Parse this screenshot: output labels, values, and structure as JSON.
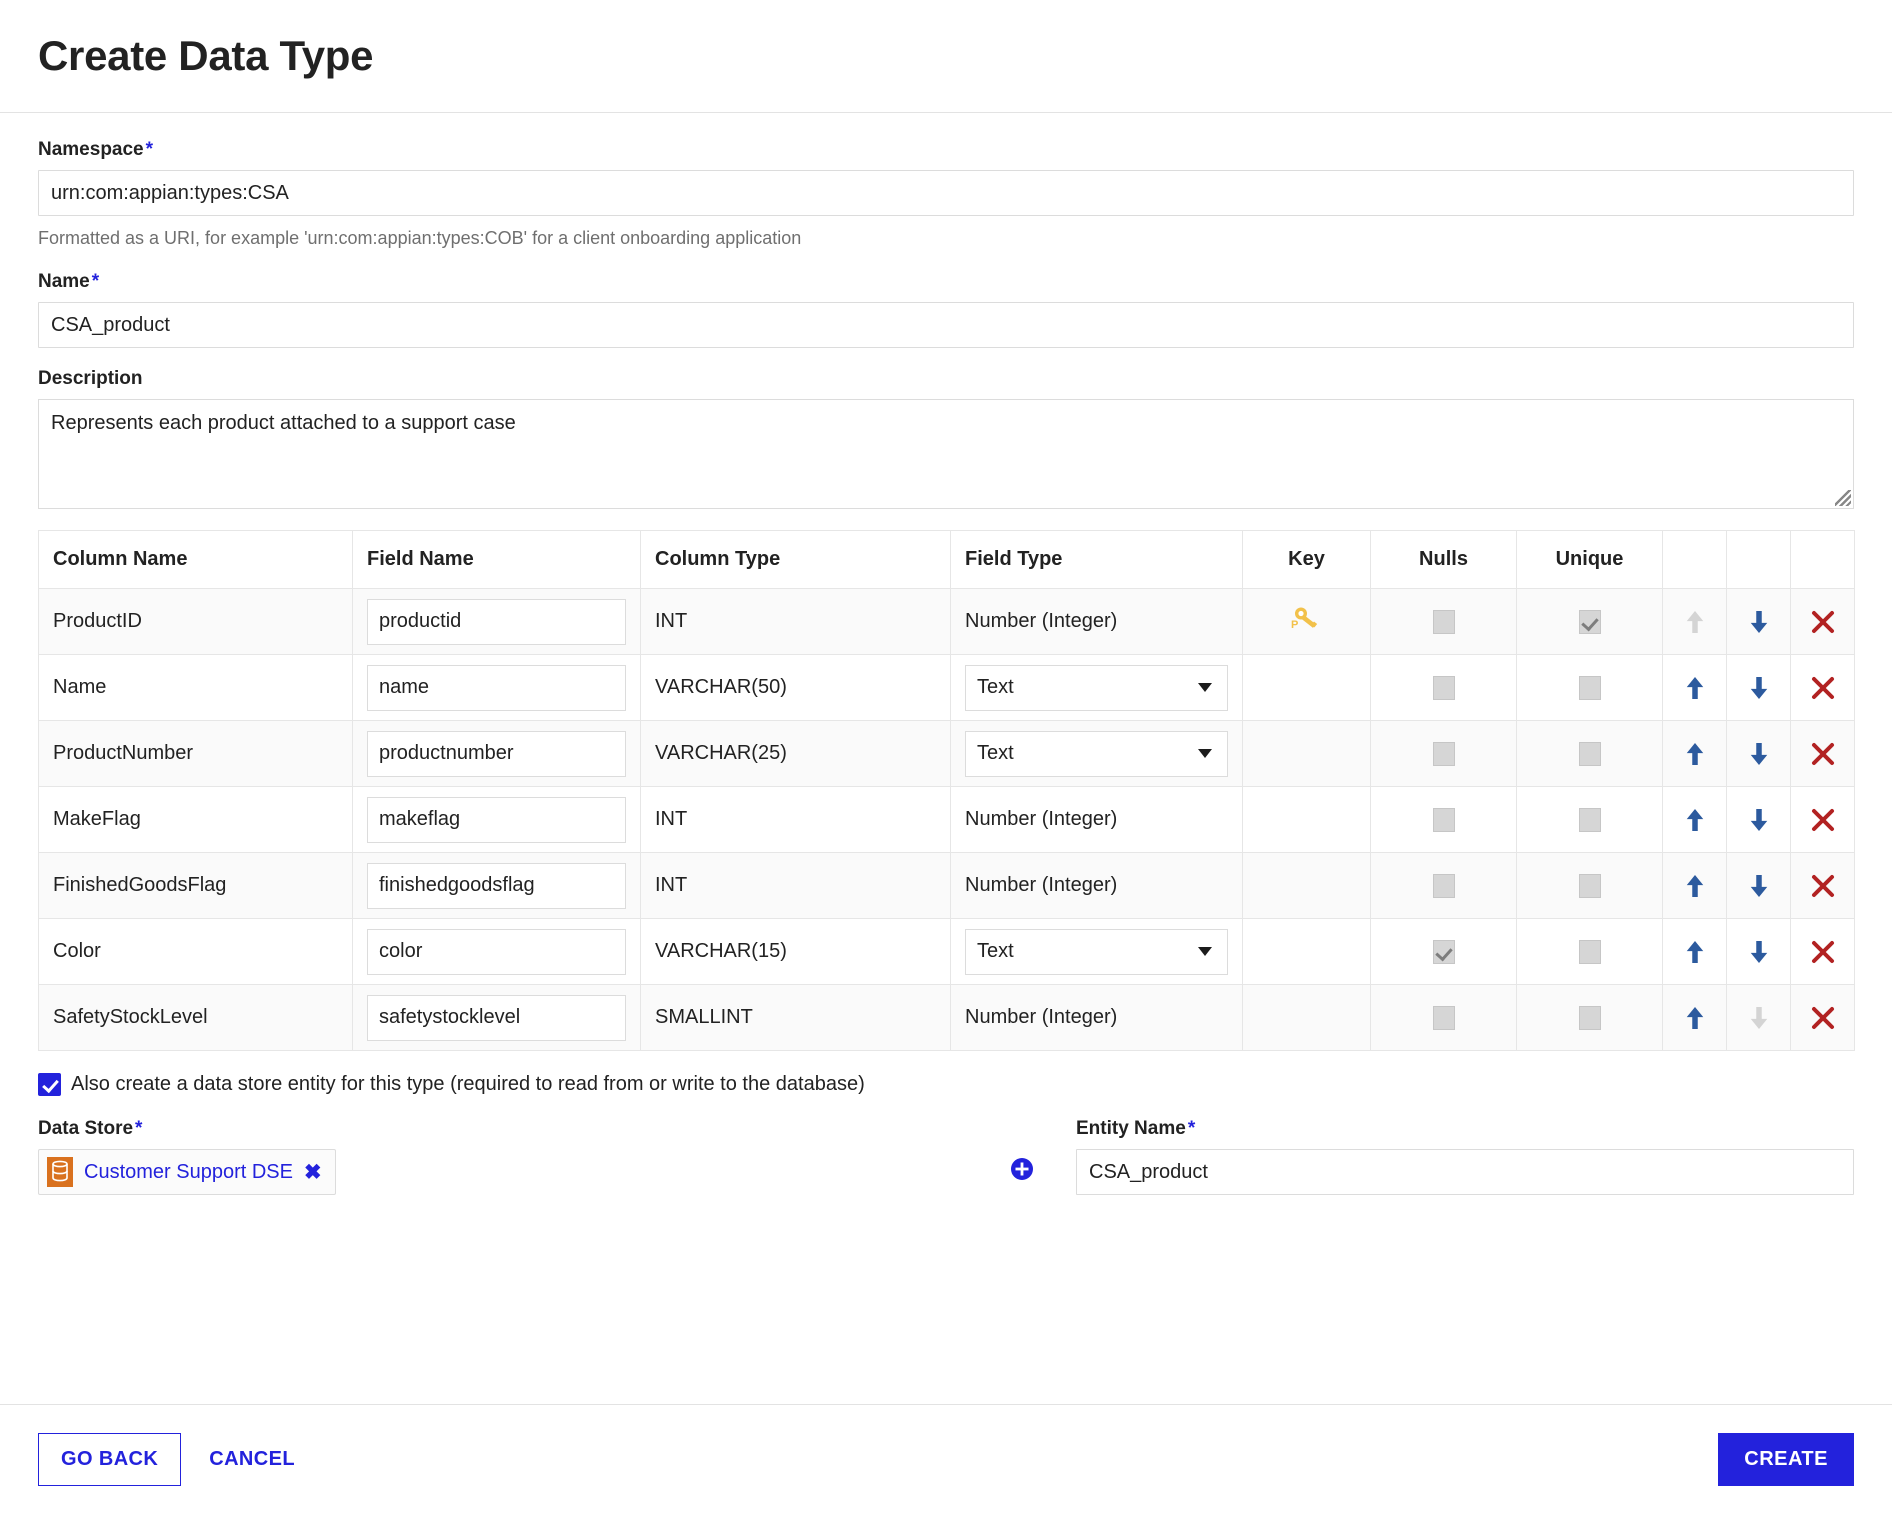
{
  "header": {
    "title": "Create Data Type"
  },
  "form": {
    "namespace": {
      "label": "Namespace",
      "required_mark": "*",
      "value": "urn:com:appian:types:CSA",
      "helper": "Formatted as a URI, for example 'urn:com:appian:types:COB' for a client onboarding application"
    },
    "name": {
      "label": "Name",
      "required_mark": "*",
      "value": "CSA_product"
    },
    "description": {
      "label": "Description",
      "value": "Represents each product attached to a support case"
    }
  },
  "table": {
    "headers": [
      "Column Name",
      "Field Name",
      "Column Type",
      "Field Type",
      "Key",
      "Nulls",
      "Unique",
      "",
      "",
      ""
    ],
    "rows": [
      {
        "column_name": "ProductID",
        "field_name": "productid",
        "column_type": "INT",
        "field_type": "Number (Integer)",
        "field_type_editable": false,
        "key": "primary-key",
        "nulls_checked": false,
        "unique_checked": true,
        "move_up_enabled": false,
        "move_down_enabled": true
      },
      {
        "column_name": "Name",
        "field_name": "name",
        "column_type": "VARCHAR(50)",
        "field_type": "Text",
        "field_type_editable": true,
        "key": "",
        "nulls_checked": false,
        "unique_checked": false,
        "move_up_enabled": true,
        "move_down_enabled": true
      },
      {
        "column_name": "ProductNumber",
        "field_name": "productnumber",
        "column_type": "VARCHAR(25)",
        "field_type": "Text",
        "field_type_editable": true,
        "key": "",
        "nulls_checked": false,
        "unique_checked": false,
        "move_up_enabled": true,
        "move_down_enabled": true
      },
      {
        "column_name": "MakeFlag",
        "field_name": "makeflag",
        "column_type": "INT",
        "field_type": "Number (Integer)",
        "field_type_editable": false,
        "key": "",
        "nulls_checked": false,
        "unique_checked": false,
        "move_up_enabled": true,
        "move_down_enabled": true
      },
      {
        "column_name": "FinishedGoodsFlag",
        "field_name": "finishedgoodsflag",
        "column_type": "INT",
        "field_type": "Number (Integer)",
        "field_type_editable": false,
        "key": "",
        "nulls_checked": false,
        "unique_checked": false,
        "move_up_enabled": true,
        "move_down_enabled": true
      },
      {
        "column_name": "Color",
        "field_name": "color",
        "column_type": "VARCHAR(15)",
        "field_type": "Text",
        "field_type_editable": true,
        "key": "",
        "nulls_checked": true,
        "unique_checked": false,
        "move_up_enabled": true,
        "move_down_enabled": true
      },
      {
        "column_name": "SafetyStockLevel",
        "field_name": "safetystocklevel",
        "column_type": "SMALLINT",
        "field_type": "Number (Integer)",
        "field_type_editable": false,
        "key": "",
        "nulls_checked": false,
        "unique_checked": false,
        "move_up_enabled": true,
        "move_down_enabled": false
      }
    ]
  },
  "data_store_section": {
    "checkbox_checked": true,
    "checkbox_label": "Also create a data store entity for this type (required to read from or write to the database)",
    "data_store": {
      "label": "Data Store",
      "required_mark": "*",
      "chip_label": "Customer Support DSE",
      "chip_remove": "✖"
    },
    "add_label": "+",
    "entity_name": {
      "label": "Entity Name",
      "required_mark": "*",
      "value": "CSA_product"
    }
  },
  "footer": {
    "go_back": "GO BACK",
    "cancel": "CANCEL",
    "create": "CREATE"
  },
  "colors": {
    "accent": "#2322dc",
    "key_icon": "#f2c14a",
    "arrow": "#2c5a9e",
    "delete": "#b22222",
    "db_icon": "#d9711e"
  }
}
